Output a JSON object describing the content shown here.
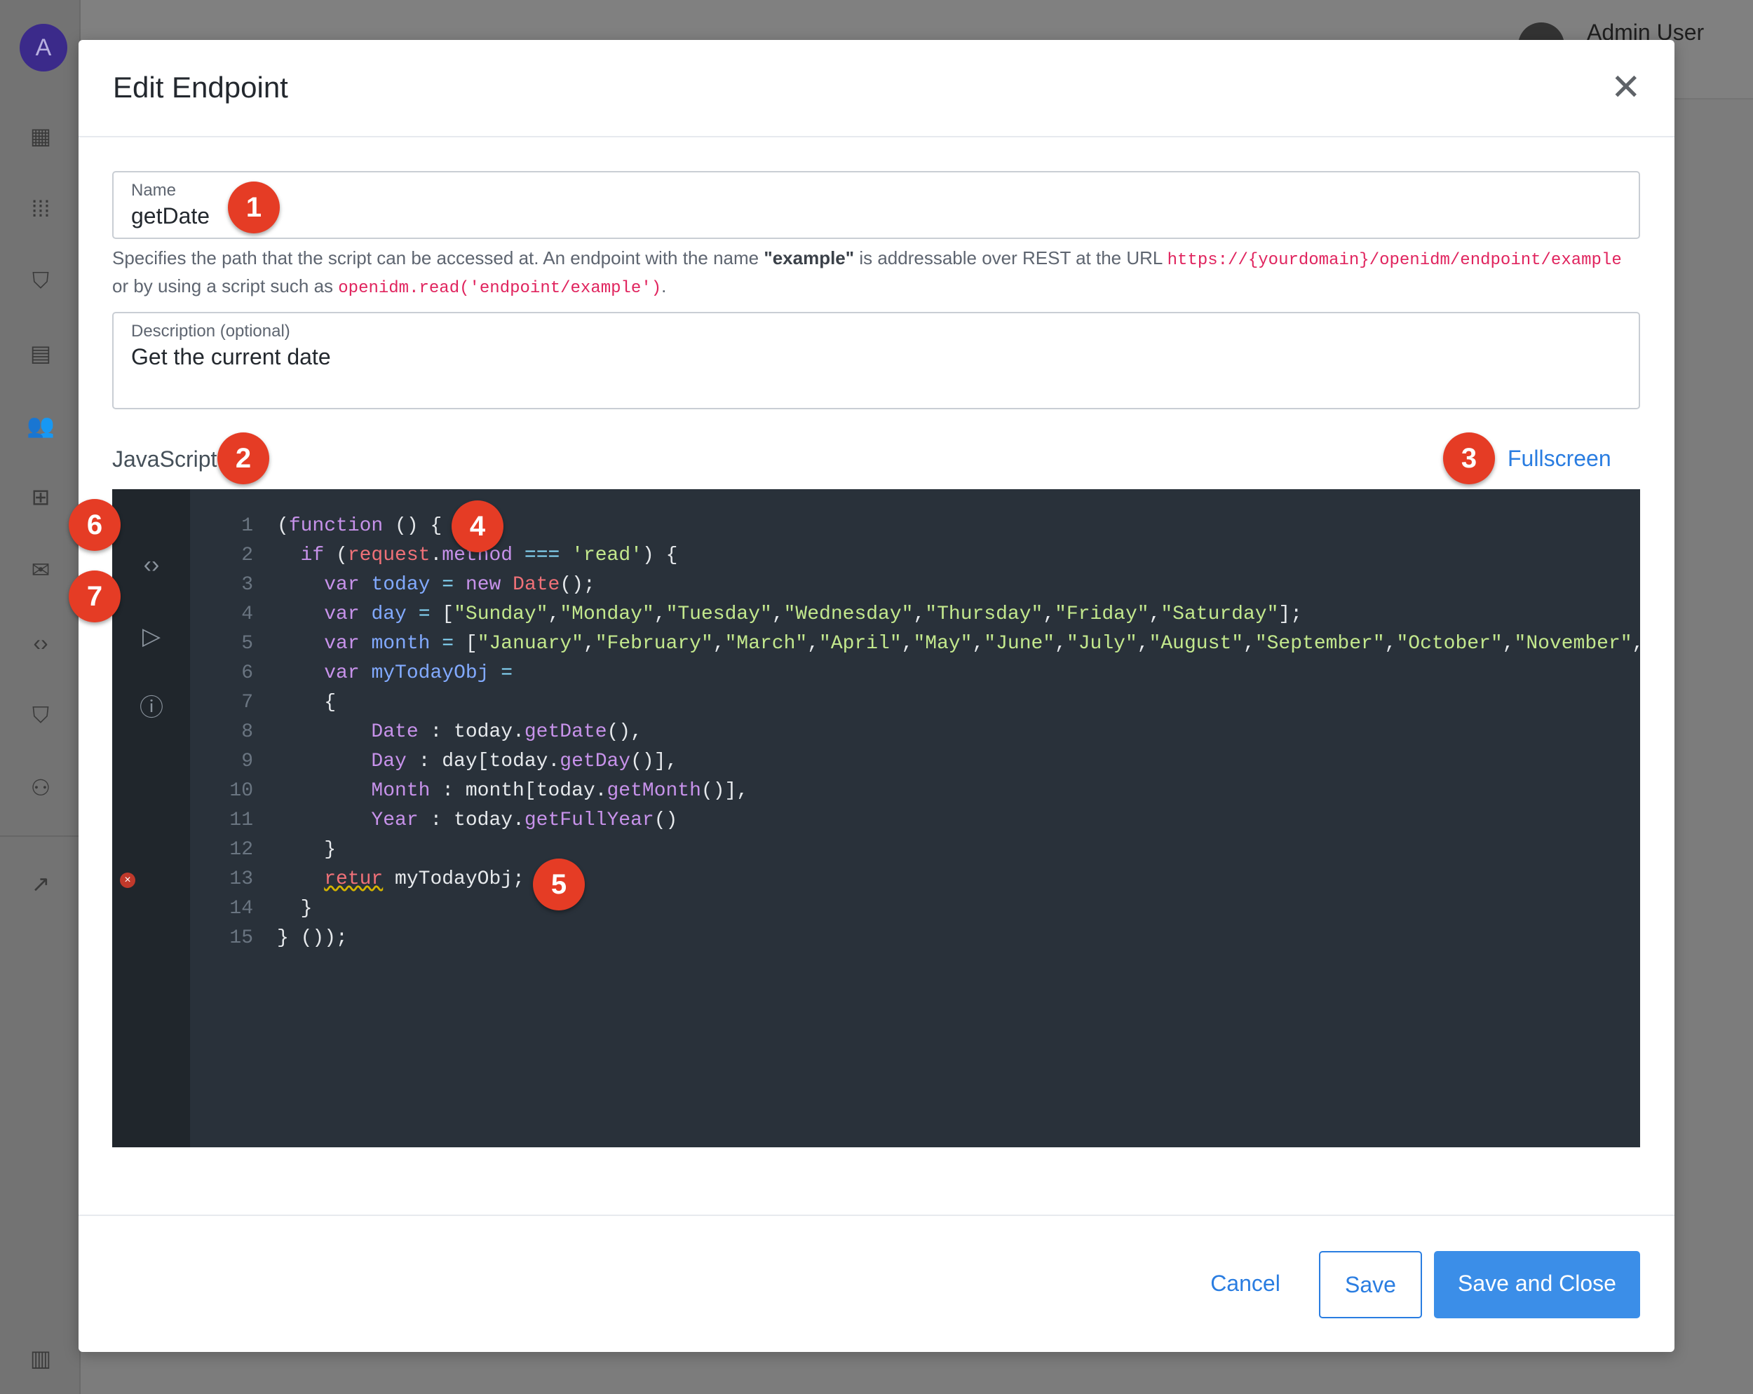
{
  "sidebar": {
    "avatar_letter": "A",
    "items": [
      "dashboard-icon",
      "apps-icon",
      "shield-check-icon",
      "form-icon",
      "users-icon",
      "hierarchy-icon",
      "mail-icon",
      "code-icon",
      "shield-icon",
      "user-check-icon",
      "external-link-icon",
      "panel-toggle-icon"
    ]
  },
  "header": {
    "user": "Admin User"
  },
  "modal": {
    "title": "Edit Endpoint",
    "name_label": "Name",
    "name_value": "getDate",
    "help_1a": "Specifies the path that the script can be accessed at. An endpoint with the name ",
    "help_1b": "\"example\"",
    "help_1c": " is addressable over REST at the URL ",
    "help_url": "https://{yourdomain}/openidm/endpoint/example",
    "help_2a": "or by using a script such as ",
    "help_2code": "openidm.read('endpoint/example')",
    "help_2b": ".",
    "desc_label": "Description (optional)",
    "desc_value": "Get the current date",
    "js_label": "JavaScript",
    "fullscreen": "Fullscreen",
    "cancel": "Cancel",
    "save": "Save",
    "save_close": "Save and Close"
  },
  "editor": {
    "error_line": 13,
    "lines": [
      [
        [
          "p",
          "("
        ],
        [
          "kw",
          "function"
        ],
        [
          "p",
          " () {"
        ]
      ],
      [
        [
          "p",
          "  "
        ],
        [
          "kw",
          "if"
        ],
        [
          "p",
          " ("
        ],
        [
          "red",
          "request"
        ],
        [
          "p",
          "."
        ],
        [
          "prop",
          "method"
        ],
        [
          "p",
          " "
        ],
        [
          "op",
          "==="
        ],
        [
          "p",
          " "
        ],
        [
          "str",
          "'read'"
        ],
        [
          "p",
          ") {"
        ]
      ],
      [
        [
          "p",
          "    "
        ],
        [
          "kw",
          "var"
        ],
        [
          "p",
          " "
        ],
        [
          "var",
          "today"
        ],
        [
          "p",
          " "
        ],
        [
          "op",
          "="
        ],
        [
          "p",
          " "
        ],
        [
          "kw",
          "new"
        ],
        [
          "p",
          " "
        ],
        [
          "red",
          "Date"
        ],
        [
          "p",
          "();"
        ]
      ],
      [
        [
          "p",
          "    "
        ],
        [
          "kw",
          "var"
        ],
        [
          "p",
          " "
        ],
        [
          "var",
          "day"
        ],
        [
          "p",
          " "
        ],
        [
          "op",
          "="
        ],
        [
          "p",
          " ["
        ],
        [
          "str",
          "\"Sunday\""
        ],
        [
          "p",
          ","
        ],
        [
          "str",
          "\"Monday\""
        ],
        [
          "p",
          ","
        ],
        [
          "str",
          "\"Tuesday\""
        ],
        [
          "p",
          ","
        ],
        [
          "str",
          "\"Wednesday\""
        ],
        [
          "p",
          ","
        ],
        [
          "str",
          "\"Thursday\""
        ],
        [
          "p",
          ","
        ],
        [
          "str",
          "\"Friday\""
        ],
        [
          "p",
          ","
        ],
        [
          "str",
          "\"Saturday\""
        ],
        [
          "p",
          "];"
        ]
      ],
      [
        [
          "p",
          "    "
        ],
        [
          "kw",
          "var"
        ],
        [
          "p",
          " "
        ],
        [
          "var",
          "month"
        ],
        [
          "p",
          " "
        ],
        [
          "op",
          "="
        ],
        [
          "p",
          " ["
        ],
        [
          "str",
          "\"January\""
        ],
        [
          "p",
          ","
        ],
        [
          "str",
          "\"February\""
        ],
        [
          "p",
          ","
        ],
        [
          "str",
          "\"March\""
        ],
        [
          "p",
          ","
        ],
        [
          "str",
          "\"April\""
        ],
        [
          "p",
          ","
        ],
        [
          "str",
          "\"May\""
        ],
        [
          "p",
          ","
        ],
        [
          "str",
          "\"June\""
        ],
        [
          "p",
          ","
        ],
        [
          "str",
          "\"July\""
        ],
        [
          "p",
          ","
        ],
        [
          "str",
          "\"August\""
        ],
        [
          "p",
          ","
        ],
        [
          "str",
          "\"September\""
        ],
        [
          "p",
          ","
        ],
        [
          "str",
          "\"October\""
        ],
        [
          "p",
          ","
        ],
        [
          "str",
          "\"November\""
        ],
        [
          "p",
          ","
        ]
      ],
      [
        [
          "p",
          "    "
        ],
        [
          "kw",
          "var"
        ],
        [
          "p",
          " "
        ],
        [
          "var",
          "myTodayObj"
        ],
        [
          "p",
          " "
        ],
        [
          "op",
          "="
        ]
      ],
      [
        [
          "p",
          "    {"
        ]
      ],
      [
        [
          "p",
          "        "
        ],
        [
          "prop",
          "Date"
        ],
        [
          "p",
          " : today."
        ],
        [
          "prop",
          "getDate"
        ],
        [
          "p",
          "(),"
        ]
      ],
      [
        [
          "p",
          "        "
        ],
        [
          "prop",
          "Day"
        ],
        [
          "p",
          " : day[today."
        ],
        [
          "prop",
          "getDay"
        ],
        [
          "p",
          "()],"
        ]
      ],
      [
        [
          "p",
          "        "
        ],
        [
          "prop",
          "Month"
        ],
        [
          "p",
          " : month[today."
        ],
        [
          "prop",
          "getMonth"
        ],
        [
          "p",
          "()],"
        ]
      ],
      [
        [
          "p",
          "        "
        ],
        [
          "prop",
          "Year"
        ],
        [
          "p",
          " : today."
        ],
        [
          "prop",
          "getFullYear"
        ],
        [
          "p",
          "()"
        ]
      ],
      [
        [
          "p",
          "    }"
        ]
      ],
      [
        [
          "p",
          "    "
        ],
        [
          "err",
          "retur"
        ],
        [
          "p",
          " myTodayObj;"
        ]
      ],
      [
        [
          "p",
          "  }"
        ]
      ],
      [
        [
          "p",
          "} ());"
        ]
      ]
    ]
  },
  "badges": [
    "1",
    "2",
    "3",
    "4",
    "5",
    "6",
    "7"
  ],
  "colors": {
    "accent": "#2a7de1",
    "badge": "#e53c25",
    "editor_bg": "#29313a"
  }
}
